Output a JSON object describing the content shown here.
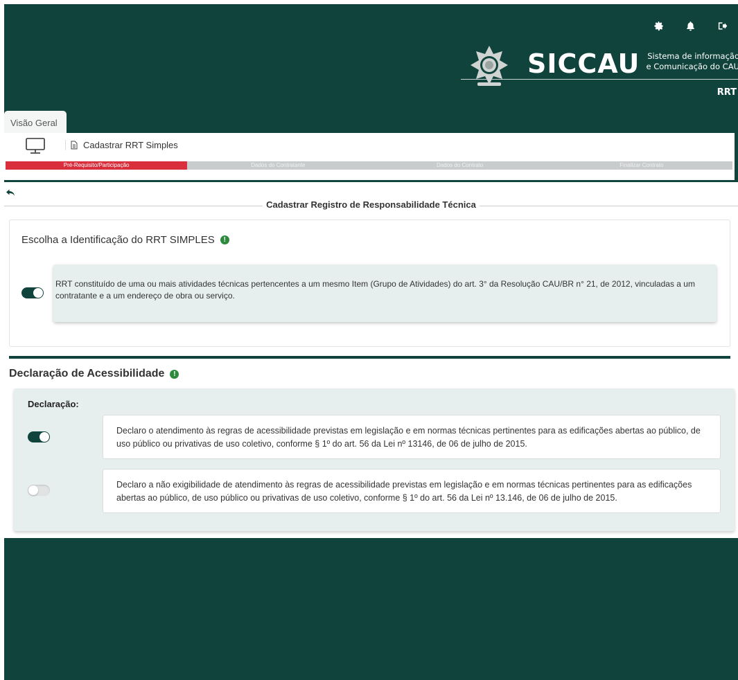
{
  "header": {
    "icons": [
      "gear-icon",
      "bell-icon",
      "logout-icon"
    ],
    "brand_name": "SICCAU",
    "brand_sub_line1": "Sistema de informação",
    "brand_sub_line2": "e Comunicação do CAU",
    "module": "RRT"
  },
  "tabs": {
    "visao_geral": "Visão Geral"
  },
  "panel": {
    "title": "Cadastrar RRT Simples",
    "steps": [
      {
        "label": "Pré-Requisito/Participação",
        "active": true
      },
      {
        "label": "Dados do Contratante",
        "active": false
      },
      {
        "label": "Dados do Contrato",
        "active": false
      },
      {
        "label": "Finalizar Contrato",
        "active": false
      }
    ]
  },
  "section": {
    "title": "Cadastrar Registro de Responsabilidade Técnica"
  },
  "identificacao": {
    "title": "Escolha a Identificação do RRT SIMPLES",
    "info_glyph": "!",
    "option_text": "RRT constituído de uma ou mais atividades técnicas pertencentes a um mesmo Item (Grupo de Atividades) do art. 3° da Resolução CAU/BR n° 21, de 2012, vinculadas a um contratante e a um endereço de obra ou serviço.",
    "option_selected": true
  },
  "acessibilidade": {
    "title": "Declaração de Acessibilidade",
    "info_glyph": "!",
    "label": "Declaração:",
    "options": [
      {
        "text": "Declaro o atendimento às regras de acessibilidade previstas em legislação e em normas técnicas pertinentes para as edificações abertas ao público, de uso público ou privativas de uso coletivo, conforme § 1º do art. 56 da Lei nº 13146, de 06 de julho de 2015.",
        "selected": true
      },
      {
        "text": "Declaro a não exigibilidade de atendimento às regras de acessibilidade previstas em legislação e em normas técnicas pertinentes para as edificações abertas ao público, de uso público ou privativas de uso coletivo, conforme § 1º do art. 56 da Lei nº 13.146, de 06 de julho de 2015.",
        "selected": false
      }
    ]
  },
  "colors": {
    "primary": "#11433d",
    "step_active": "#d92f3d",
    "step_inactive": "#c9cccd",
    "info_green": "#2e8b3e",
    "option_bg": "#e6efee"
  }
}
